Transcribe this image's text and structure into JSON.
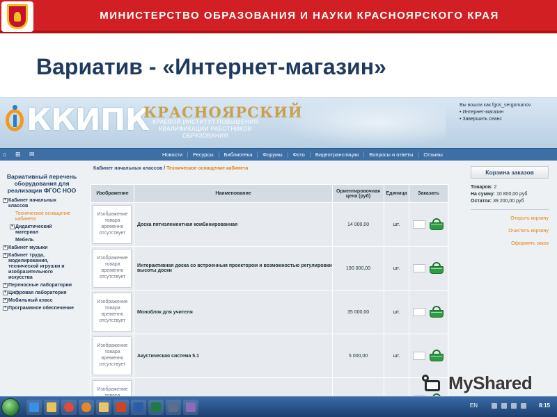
{
  "ministry": {
    "title": "МИНИСТЕРСТВО ОБРАЗОВАНИЯ И НАУКИ КРАСНОЯРСКОГО КРАЯ"
  },
  "slide": {
    "title": "Вариатив - «Интернет-магазин»"
  },
  "site": {
    "logo_text": "ККИПК",
    "institute_name": "КРАСНОЯРСКИЙ",
    "institute_sub": [
      "КРАЕВОЙ ИНСТИТУТ ПОВЫШЕНИЯ",
      "КВАЛИФИКАЦИИ РАБОТНИКОВ",
      "ОБРАЗОВАНИЯ"
    ],
    "login": {
      "logged_as": "Вы вошли как fgos_sergomanov",
      "link_shop": "• Интернет-магазин",
      "link_logout": "• Завершить сеанс"
    },
    "nav": [
      "Новости",
      "Ресурсы",
      "Библиотека",
      "Форумы",
      "Фото",
      "Видеотрансляция",
      "Вопросы и ответы",
      "Отзывы"
    ]
  },
  "left_menu": {
    "title": [
      "Вариативный перечень",
      "оборудования для",
      "реализации ФГОС НОО"
    ],
    "items": [
      {
        "label": "Кабинет начальных классов",
        "lines": [
          "Кабинет начальных",
          "классов"
        ]
      },
      {
        "label": "Техническое оснащение кабинета",
        "lines": [
          "Техническое оснащение",
          "кабинета"
        ]
      },
      {
        "label": "Дидактический материал",
        "lines": [
          "Дидактический",
          "материал"
        ]
      },
      {
        "label": "Мебель",
        "lines": [
          "Мебель"
        ]
      },
      {
        "label": "Кабинет музыки",
        "lines": [
          "Кабинет музыки"
        ]
      },
      {
        "label": "Кабинет труда, моделирования, технической игрушки и изобразительного искусства",
        "lines": [
          "Кабинет труда,",
          "моделирования,",
          "технической игрушки и",
          "изобразительного",
          "искусства"
        ]
      },
      {
        "label": "Переносные лаборатории",
        "lines": [
          "Переносные лаборатории"
        ]
      },
      {
        "label": "Цифровая лаборатория",
        "lines": [
          "Цифровая лаборатория"
        ]
      },
      {
        "label": "Мобильный класс",
        "lines": [
          "Мобильный класс"
        ]
      },
      {
        "label": "Программное обеспечение",
        "lines": [
          "Программное обеспечение"
        ]
      }
    ]
  },
  "breadcrumb": {
    "parent": "Кабинет начальных классов",
    "separator": " / ",
    "current": "Техническое оснащение кабинета"
  },
  "table": {
    "headers": [
      "Изображение",
      "Наименование",
      "Ориентировочная цена (руб)",
      "Единица",
      "Заказать"
    ],
    "no_image_lines": [
      "Изображение",
      "товара",
      "временно",
      "отсутствует"
    ],
    "rows": [
      {
        "name": "Доска пятиэлементная комбинированная",
        "price": "14 000,00",
        "unit": "шт."
      },
      {
        "name": "Интерактивная доска со встроенным проектором и возможностью регулировки высоты доски",
        "price": "190 000,00",
        "unit": "шт."
      },
      {
        "name": "Моноблок для учителя",
        "price": "35 000,00",
        "unit": "шт."
      },
      {
        "name": "Акустическая система 5.1",
        "price": "5 000,00",
        "unit": "шт."
      },
      {
        "name": "",
        "price": "",
        "unit": ""
      }
    ]
  },
  "cart": {
    "title": "Корзина заказов",
    "items_label": "Товаров:",
    "items_value": "2",
    "sum_label": "На сумму:",
    "sum_value": "10 800,00 руб",
    "rest_label": "Остаток:",
    "rest_value": "39 200,00 руб",
    "links": [
      "Открыть корзину",
      "Очистить корзину",
      "Оформить заказ"
    ]
  },
  "watermark": {
    "text": "MyShared"
  },
  "taskbar": {
    "lang": "EN",
    "clock": "8:15"
  },
  "colors": {
    "ministry_red": "#d21f24",
    "title_blue": "#1f3a5f",
    "nav_blue": "#3c6fa3",
    "accent_orange": "#e07f10"
  }
}
